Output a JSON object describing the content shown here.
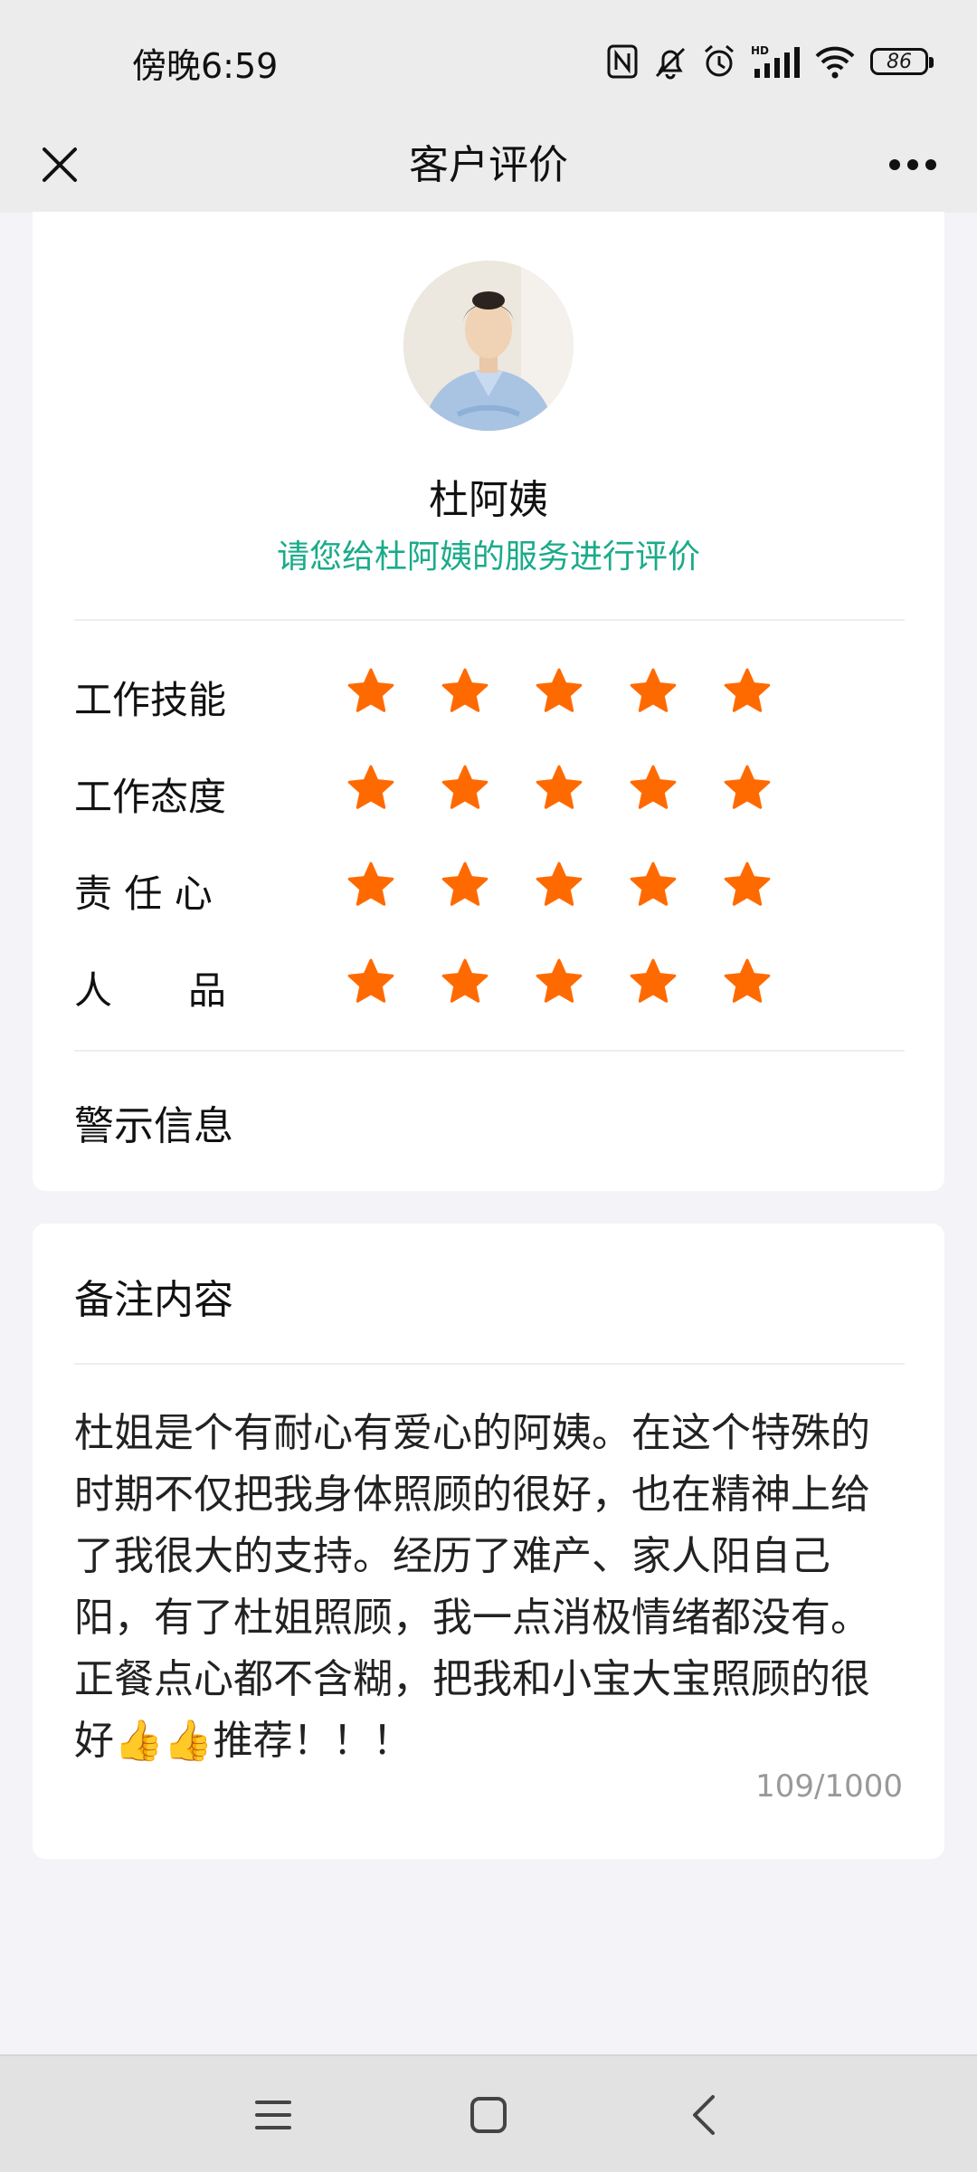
{
  "status_bar": {
    "time": "傍晚6:59",
    "battery": "86",
    "icons": [
      "nfc-icon",
      "mute-bell-icon",
      "alarm-icon",
      "hd-signal-icon",
      "wifi-icon",
      "battery-icon"
    ]
  },
  "header": {
    "title": "客户评价",
    "close_icon": "close-icon",
    "more_icon": "more-icon"
  },
  "profile": {
    "name": "杜阿姨",
    "prompt": "请您给杜阿姨的服务进行评价"
  },
  "ratings": [
    {
      "label": "工作技能",
      "stars": 5,
      "max": 5
    },
    {
      "label": "工作态度",
      "stars": 5,
      "max": 5
    },
    {
      "label": "责 任 心",
      "stars": 5,
      "max": 5
    },
    {
      "label": "人　　品",
      "stars": 5,
      "max": 5
    }
  ],
  "warning": {
    "label": "警示信息"
  },
  "remarks": {
    "title": "备注内容",
    "text": "杜姐是个有耐心有爱心的阿姨。在这个特殊的时期不仅把我身体照顾的很好，也在精神上给了我很大的支持。经历了难产、家人阳自己阳，有了杜姐照顾，我一点消极情绪都没有。正餐点心都不含糊，把我和小宝大宝照顾的很好👍👍推荐！！！",
    "counter": "109/1000"
  },
  "colors": {
    "star": "#ff6a00",
    "accent": "#1aab8a",
    "background": "#f3f3f8"
  },
  "navbar": {
    "icons": [
      "menu-icon",
      "home-icon",
      "back-icon"
    ]
  }
}
